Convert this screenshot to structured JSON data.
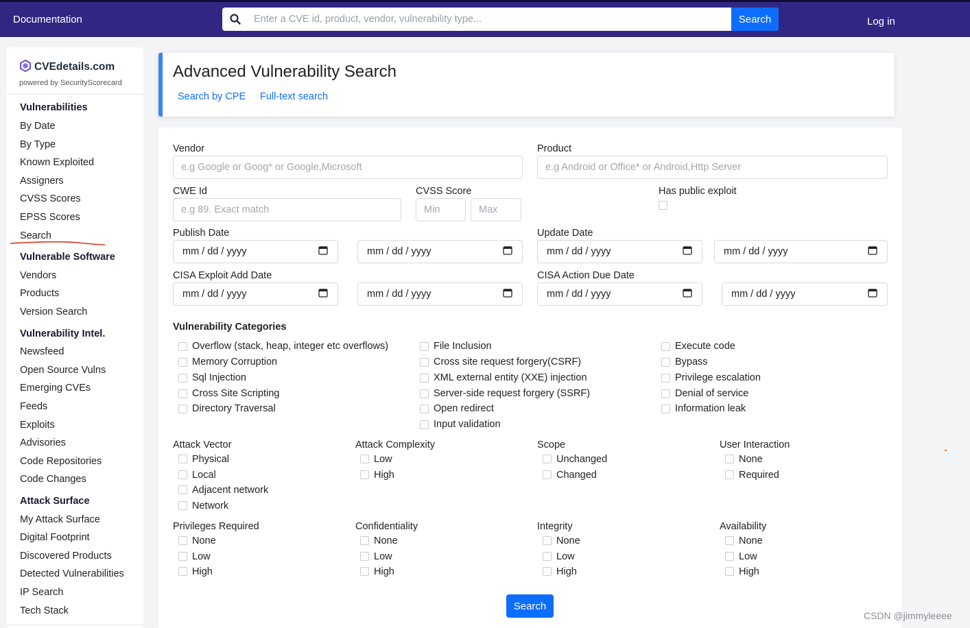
{
  "topbar": {
    "doc_link": "Documentation",
    "search_placeholder": "Enter a CVE id, product, vendor, vulnerability type...",
    "search_button": "Search",
    "login": "Log in"
  },
  "sidebar": {
    "brand_name": "CVEdetails.com",
    "brand_sub": "powered by SecurityScorecard",
    "sections": [
      {
        "title": "Vulnerabilities",
        "items": [
          "By Date",
          "By Type",
          "Known Exploited",
          "Assigners",
          "CVSS Scores",
          "EPSS Scores",
          "Search"
        ]
      },
      {
        "title": "Vulnerable Software",
        "items": [
          "Vendors",
          "Products",
          "Version Search"
        ]
      },
      {
        "title": "Vulnerability Intel.",
        "items": [
          "Newsfeed",
          "Open Source Vulns",
          "Emerging CVEs",
          "Feeds",
          "Exploits",
          "Advisories",
          "Code Repositories",
          "Code Changes"
        ]
      },
      {
        "title": "Attack Surface",
        "items": [
          "My Attack Surface",
          "Digital Footprint",
          "Discovered Products",
          "Detected Vulnerabilities",
          "IP Search",
          "Tech Stack"
        ]
      }
    ]
  },
  "header": {
    "title": "Advanced Vulnerability Search",
    "links": [
      "Search by CPE",
      "Full-text search"
    ]
  },
  "form": {
    "vendor_label": "Vendor",
    "vendor_placeholder": "e.g Google or Goog* or Google,Microsoft",
    "product_label": "Product",
    "product_placeholder": "e.g Android or Office* or Android,Http Server",
    "cwe_label": "CWE Id",
    "cwe_placeholder": "e.g 89. Exact match",
    "cvss_label": "CVSS Score",
    "cvss_min": "Min",
    "cvss_max": "Max",
    "exploit_label": "Has public exploit",
    "publish_label": "Publish Date",
    "update_label": "Update Date",
    "cisa_add_label": "CISA Exploit Add Date",
    "cisa_due_label": "CISA Action Due Date",
    "date_placeholder": "mm / dd / yyyy",
    "categories_title": "Vulnerability Categories",
    "categories": [
      [
        "Overflow (stack, heap, integer etc overflows)",
        "Memory Corruption",
        "Sql Injection",
        "Cross Site Scripting",
        "Directory Traversal"
      ],
      [
        "File Inclusion",
        "Cross site request forgery(CSRF)",
        "XML external entity (XXE) injection",
        "Server-side request forgery (SSRF)",
        "Open redirect",
        "Input validation"
      ],
      [
        "Execute code",
        "Bypass",
        "Privilege escalation",
        "Denial of service",
        "Information leak"
      ]
    ],
    "metrics_row1": [
      {
        "title": "Attack Vector",
        "options": [
          "Physical",
          "Local",
          "Adjacent network",
          "Network"
        ]
      },
      {
        "title": "Attack Complexity",
        "options": [
          "Low",
          "High"
        ]
      },
      {
        "title": "Scope",
        "options": [
          "Unchanged",
          "Changed"
        ]
      },
      {
        "title": "User Interaction",
        "options": [
          "None",
          "Required"
        ]
      }
    ],
    "metrics_row2": [
      {
        "title": "Privileges Required",
        "options": [
          "None",
          "Low",
          "High"
        ]
      },
      {
        "title": "Confidentiality",
        "options": [
          "None",
          "Low",
          "High"
        ]
      },
      {
        "title": "Integrity",
        "options": [
          "None",
          "Low",
          "High"
        ]
      },
      {
        "title": "Availability",
        "options": [
          "None",
          "Low",
          "High"
        ]
      }
    ],
    "submit": "Search"
  },
  "watermark": "CSDN @jimmyleeee",
  "colors": {
    "topbar": "#312783",
    "primary": "#0d6efd",
    "accent_border": "#3b82f6"
  }
}
